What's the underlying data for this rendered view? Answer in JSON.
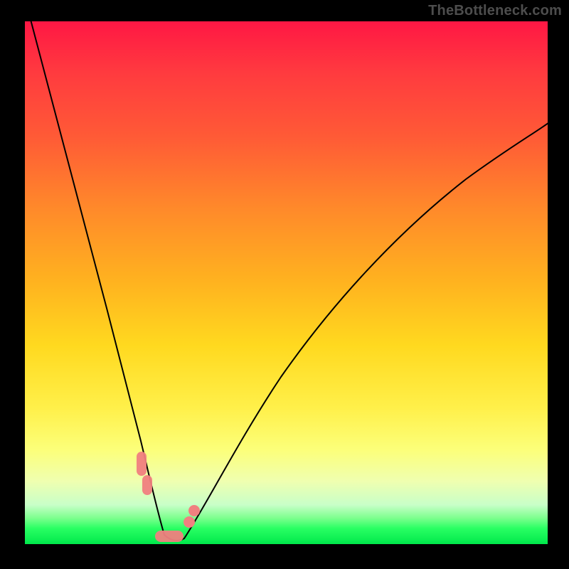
{
  "watermark_text": "TheBottleneck.com",
  "colors": {
    "watermark": "#4d4d4d",
    "curve": "#000000",
    "marker": "#f08080"
  },
  "chart_data": {
    "type": "line",
    "title": "",
    "xlabel": "",
    "ylabel": "",
    "xlim": [
      0,
      100
    ],
    "ylim": [
      0,
      100
    ],
    "note": "V-shaped bottleneck curve over red→green vertical gradient. Values are read as relative percent of plot width/height.",
    "series": [
      {
        "name": "bottleneck_curve",
        "x": [
          0,
          3,
          7,
          10,
          13,
          16,
          19,
          21,
          23.5,
          25.5,
          27.5,
          29.5,
          32,
          35,
          40,
          47,
          55,
          63,
          72,
          82,
          92,
          100
        ],
        "y": [
          100,
          90,
          78,
          67,
          55,
          44,
          33,
          23,
          12,
          5,
          0,
          0,
          5,
          13,
          25,
          40,
          53,
          63,
          72,
          79.5,
          84,
          86
        ]
      }
    ],
    "markers": {
      "name": "highlighted_range",
      "type": "band",
      "x_range": [
        22,
        33
      ],
      "note": "salmon pill-shaped highlights near the valley"
    }
  }
}
